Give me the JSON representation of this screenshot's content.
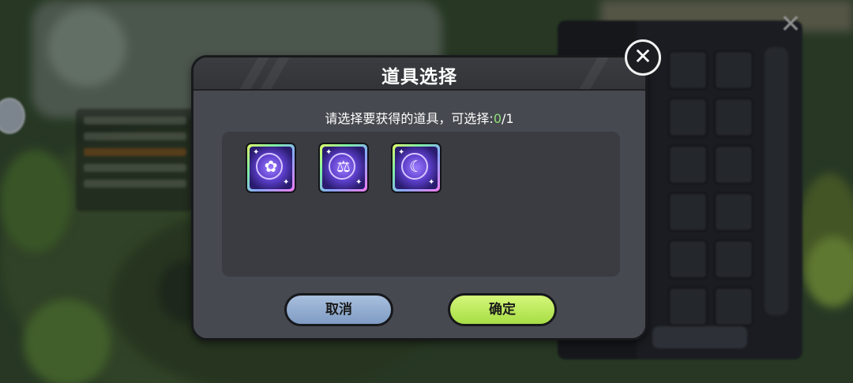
{
  "dialog": {
    "title": "道具选择",
    "prompt_prefix": "请选择要获得的道具，可选择:",
    "selected_count": "0",
    "max_count": "/1",
    "cancel_label": "取消",
    "confirm_label": "确定"
  },
  "items": [
    {
      "icon": "purple-flower-orb-icon",
      "glyph": "✿"
    },
    {
      "icon": "purple-scale-orb-icon",
      "glyph": "⚖"
    },
    {
      "icon": "purple-moon-orb-icon",
      "glyph": "☾"
    }
  ],
  "colors": {
    "dialog_bg": "#45484e",
    "cancel": "#8fa8cf",
    "confirm": "#bdec5e",
    "highlight": "#8fe07a"
  },
  "icons": {
    "close": "close-icon",
    "inventory_close": "close-icon"
  }
}
